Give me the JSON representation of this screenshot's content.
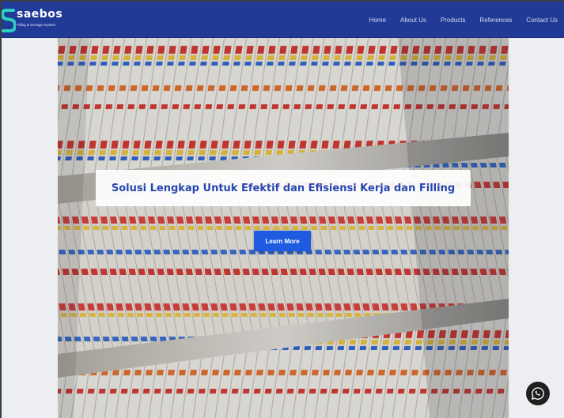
{
  "brand": {
    "name": "saebos",
    "tagline": "Filling & Storage System",
    "logo_icon": "s-shape-logo-icon",
    "primary_color": "#213a96"
  },
  "nav": {
    "items": [
      {
        "label": "Home"
      },
      {
        "label": "About Us"
      },
      {
        "label": "Products"
      },
      {
        "label": "References"
      },
      {
        "label": "Contact Us"
      }
    ]
  },
  "hero": {
    "image": "file-shelves-photo",
    "headline": "Solusi Lengkap Untuk Efektif dan Efisiensi Kerja dan Filling",
    "cta_label": "Learn More",
    "accent_color": "#1e5be0"
  },
  "floating": {
    "whatsapp_icon": "whatsapp-icon"
  }
}
